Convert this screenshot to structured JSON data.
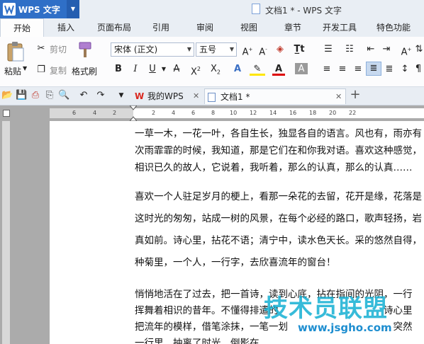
{
  "app": {
    "name": "WPS 文字",
    "window_title": "文档1 * - WPS 文字"
  },
  "menu_tabs": [
    "开始",
    "插入",
    "页面布局",
    "引用",
    "审阅",
    "视图",
    "章节",
    "开发工具",
    "特色功能"
  ],
  "ribbon": {
    "paste": "粘贴",
    "cut": "剪切",
    "copy": "复制",
    "format_painter": "格式刷",
    "font": "宋体 (正文)",
    "size": "五号"
  },
  "doc_tabs": [
    {
      "label": "我的WPS",
      "active": false
    },
    {
      "label": "文档1 *",
      "active": true
    }
  ],
  "ruler_numbers": [
    "6",
    "4",
    "2",
    "2",
    "4",
    "6",
    "8",
    "10",
    "12",
    "14",
    "16",
    "18",
    "20",
    "22"
  ],
  "document": {
    "lines": [
      "一草一木，一花一叶，各自生长，独显各自的语言。风也有，雨亦有",
      "次雨霏霏的时候，我知道，那是它们在和你我对语。喜欢这种感觉，",
      "相识已久的故人，它说着，我听着，那么的认真，那么的认真……",
      "喜欢一个人驻足岁月的梗上，看那一朵花的去留，花开是缘，花落是",
      "这时光的匆匆，站成一树的风景，在每个必经的路口，歌声轻扬，岩",
      "真如前。诗心里，拈花不语；清宁中，读水色天长。采的悠然自得，",
      "种菊里，一个人，一行字，去欣喜流年的窗台！",
      "悄悄地活在了过去，把一首诗，读到心底，拈在指间的光阴，一行",
      "挥舞着相识的昔年。不懂得排遣的　　　　　　　　　　　诗心里",
      "把流年的模样，借笔涂抹，一笔一划　　　　　　　　　　，突然",
      "一行里，抽离了时光，倒影在　　　　　　　　　　　"
    ]
  },
  "watermark": {
    "text": "技术员联盟",
    "url": "www.jsgho.com"
  },
  "colors": {
    "brand": "#2f6fc7",
    "watermark": "#14afd2"
  }
}
